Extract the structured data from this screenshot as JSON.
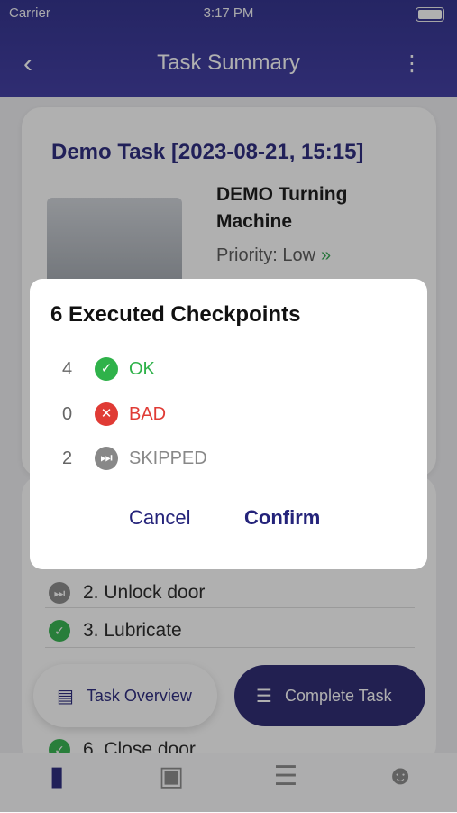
{
  "status": {
    "carrier": "Carrier",
    "time": "3:17 PM"
  },
  "nav": {
    "title": "Task Summary"
  },
  "task": {
    "title": "Demo Task [2023-08-21, 15:15]",
    "machine": "DEMO Turning Machine",
    "priority": "Priority: Low"
  },
  "checklist": [
    {
      "label": "2. Unlock door",
      "status": "skipped"
    },
    {
      "label": "3. Lubricate",
      "status": "ok"
    },
    {
      "label": "6. Close door",
      "status": "ok"
    }
  ],
  "fab": {
    "overview": "Task Overview",
    "complete": "Complete Task"
  },
  "dialog": {
    "title": "6 Executed Checkpoints",
    "ok": {
      "count": "4",
      "label": "OK"
    },
    "bad": {
      "count": "0",
      "label": "BAD"
    },
    "skipped": {
      "count": "2",
      "label": "SKIPPED"
    },
    "cancel": "Cancel",
    "confirm": "Confirm"
  },
  "colors": {
    "primary": "#24237a",
    "ok": "#2fb24a",
    "bad": "#e03b35",
    "skip": "#888888"
  },
  "tabs": [
    "document-icon",
    "cube-icon",
    "checklist-icon",
    "people-icon"
  ]
}
